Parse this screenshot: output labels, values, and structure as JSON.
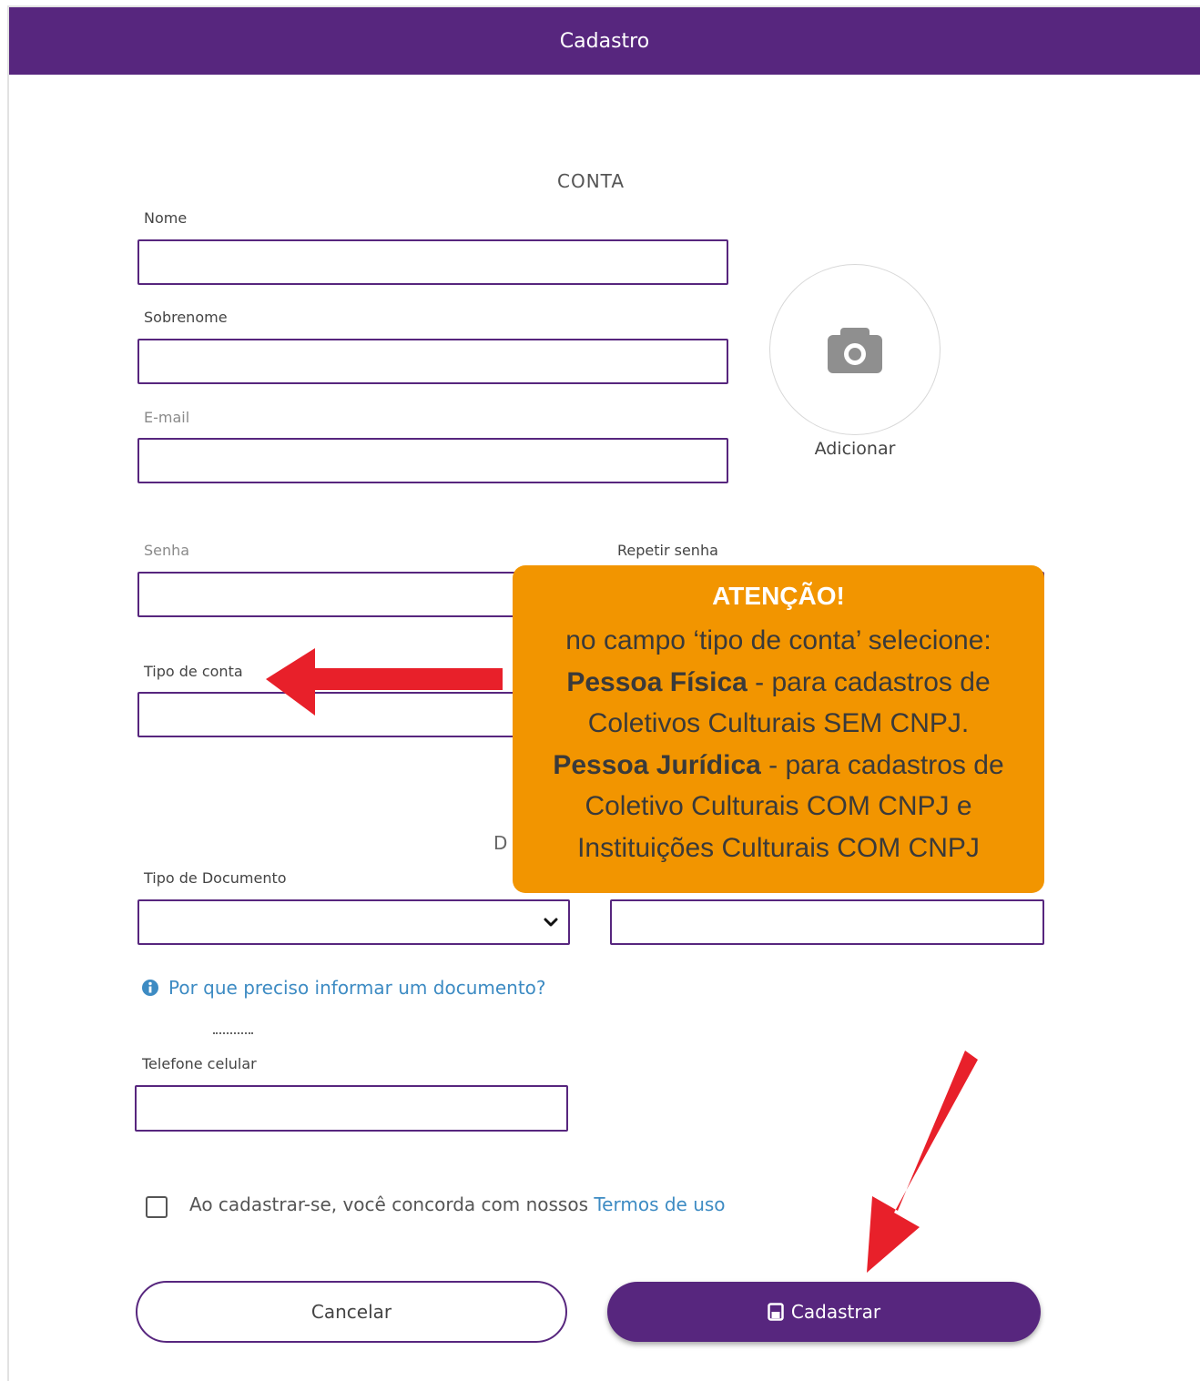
{
  "header": {
    "title": "Cadastro"
  },
  "account": {
    "section_title": "CONTA",
    "first_name_label": "Nome",
    "last_name_label": "Sobrenome",
    "email_label": "E-mail",
    "password_label": "Senha",
    "repeat_password_label": "Repetir senha",
    "account_type_label": "Tipo de conta",
    "avatar_label": "Adicionar",
    "avatar_icon": "camera-icon"
  },
  "documents": {
    "section_title_fragment": "D",
    "document_type_label": "Tipo de Documento",
    "document_type_value": "",
    "info_link": "Por que preciso informar um documento?"
  },
  "phone": {
    "mobile_label": "Telefone celular"
  },
  "terms": {
    "text": "Ao cadastrar-se, você concorda com nossos",
    "link": "Termos de uso"
  },
  "actions": {
    "cancel_label": "Cancelar",
    "submit_label": "Cadastrar",
    "submit_icon": "save-icon"
  },
  "callout": {
    "title": "ATENÇÃO!",
    "line1": "no campo ‘tipo de conta’ selecione:",
    "line2_bold": "Pessoa Física",
    "line2_rest": " - para cadastros de",
    "line3": "Coletivos Culturais SEM CNPJ.",
    "line4_bold": "Pessoa Jurídica",
    "line4_rest": " - para cadastros de",
    "line5": "Coletivo Culturais COM CNPJ e",
    "line6": "Instituições Culturais COM CNPJ"
  },
  "colors": {
    "brand": "#57267e",
    "callout": "#f29500",
    "arrow": "#e8202a",
    "link": "#3d8bc3"
  }
}
